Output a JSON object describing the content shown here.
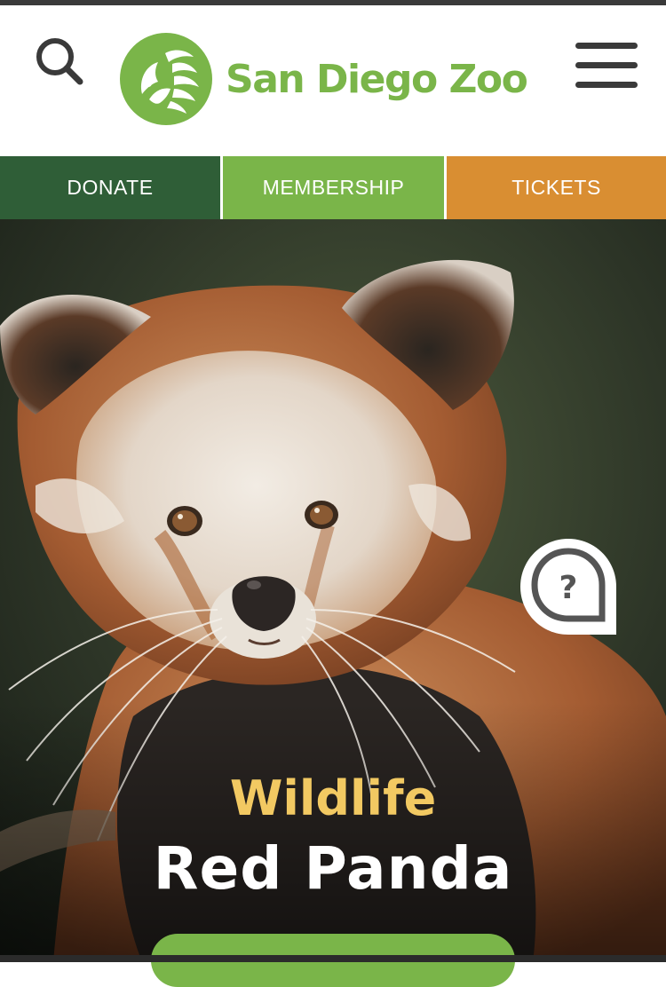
{
  "brand": {
    "name": "San Diego Zoo",
    "green": "#7ab549",
    "dark_green": "#2f5e37",
    "orange": "#d98e32",
    "gold": "#f2c962"
  },
  "header": {
    "search_icon": "search-icon",
    "menu_icon": "hamburger-menu-icon",
    "logo_icon": "zoo-lion-logo-icon"
  },
  "actions": [
    {
      "label": "DONATE",
      "color": "#2f5e37"
    },
    {
      "label": "MEMBERSHIP",
      "color": "#7ab549"
    },
    {
      "label": "TICKETS",
      "color": "#d98e32"
    }
  ],
  "hero": {
    "eyebrow": "Wildlife",
    "title": "Red Panda",
    "help_icon": "question-bubble-icon",
    "image": "red-panda-photo"
  }
}
